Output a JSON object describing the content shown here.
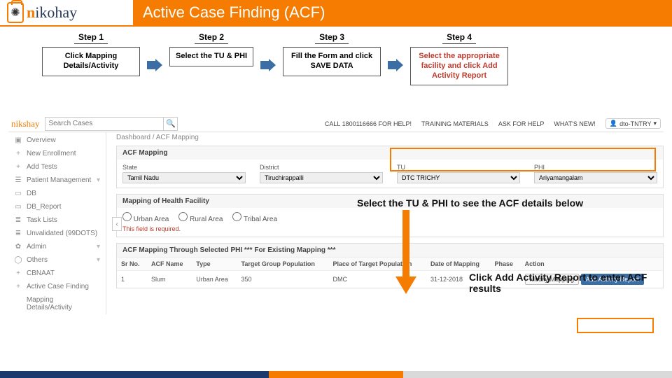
{
  "header": {
    "title": "Active Case Finding (ACF)",
    "logo_main": "ikohay",
    "logo_prefix": "n"
  },
  "steps": [
    {
      "label": "Step 1",
      "text": "Click Mapping Details/Activity"
    },
    {
      "label": "Step 2",
      "text": "Select the TU & PHI"
    },
    {
      "label": "Step 3",
      "text": "Fill the Form and click SAVE DATA"
    },
    {
      "label": "Step 4",
      "text": "Select the appropriate facility and click Add Activity Report"
    }
  ],
  "app": {
    "logo": "nikshay",
    "search_placeholder": "Search Cases",
    "links": {
      "call": "CALL 1800116666 FOR HELP!",
      "training": "TRAINING MATERIALS",
      "ask": "ASK FOR HELP",
      "whatsnew": "WHAT'S NEW!",
      "user": "dto-TNTRY"
    },
    "sidebar": [
      {
        "icon": "▣",
        "label": "Overview"
      },
      {
        "icon": "+",
        "label": "New Enrollment"
      },
      {
        "icon": "+",
        "label": "Add Tests"
      },
      {
        "icon": "☰",
        "label": "Patient Management",
        "chev": true
      },
      {
        "icon": "▭",
        "label": "DB"
      },
      {
        "icon": "▭",
        "label": "DB_Report"
      },
      {
        "icon": "≣",
        "label": "Task Lists"
      },
      {
        "icon": "≣",
        "label": "Unvalidated (99DOTS)"
      },
      {
        "icon": "✿",
        "label": "Admin",
        "chev": true
      },
      {
        "icon": "◯",
        "label": "Others",
        "chev": true
      },
      {
        "icon": "+",
        "label": "CBNAAT"
      },
      {
        "icon": "+",
        "label": "Active Case Finding"
      },
      {
        "icon": "",
        "label": "Mapping Details/Activity"
      }
    ],
    "breadcrumb": "Dashboard  /  ACF Mapping",
    "panel1_title": "ACF Mapping",
    "filters": {
      "state_l": "State",
      "state_v": "Tamil Nadu",
      "district_l": "District",
      "district_v": "Tiruchirappalli",
      "tu_l": "TU",
      "tu_v": "DTC TRICHY",
      "phi_l": "PHI",
      "phi_v": "Ariyamangalam"
    },
    "panel2_title": "Mapping of Health Facility",
    "radios": {
      "a": "Urban Area",
      "b": "Rural Area",
      "c": "Tribal Area"
    },
    "required": "This field is required.",
    "panel3_title": "ACF Mapping Through Selected PHI *** For Existing Mapping ***",
    "table": {
      "cols": [
        "Sr No.",
        "ACF Name",
        "Type",
        "Target Group Population",
        "Place of Target Population",
        "Date of Mapping",
        "Phase",
        "Action"
      ],
      "row": {
        "sr": "1",
        "name": "Slum",
        "type": "Urban Area",
        "pop": "350",
        "place": "DMC",
        "date": "31-12-2018",
        "phase": ""
      },
      "btn_modify": "Modify Mapping",
      "btn_add": "Add Activity Report"
    }
  },
  "annotations": {
    "a1": "Select the TU & PHI to see the ACF details below",
    "a2": "Click Add Activity Report to enter ACF results"
  },
  "footer_colors": [
    "#1a3a6e",
    "#1a3a6e",
    "#f57c00",
    "#d9d9d9",
    "#d9d9d9"
  ]
}
